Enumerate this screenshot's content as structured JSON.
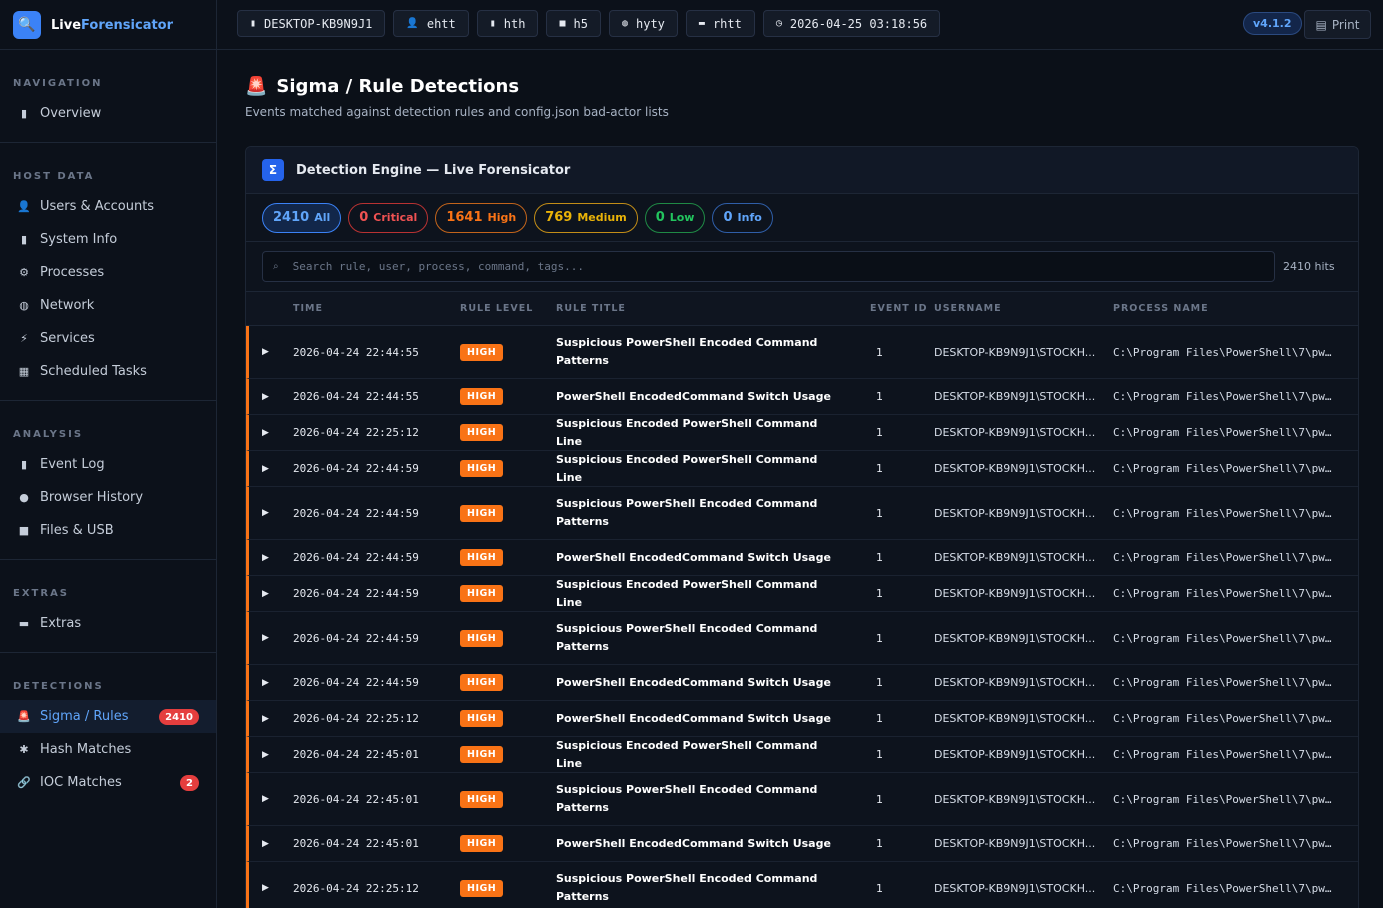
{
  "brand": {
    "name_a": "Live",
    "name_b": "Forensicator",
    "icon": "magnifier-icon"
  },
  "topbar": {
    "chips": [
      {
        "icon": "computer-icon",
        "glyph": "▮",
        "label": "DESKTOP-KB9N9J1"
      },
      {
        "icon": "user-icon",
        "glyph": "👤",
        "label": "ehtt"
      },
      {
        "icon": "document-icon",
        "glyph": "▮",
        "label": "hth"
      },
      {
        "icon": "folder-icon",
        "glyph": "■",
        "label": "h5"
      },
      {
        "icon": "globe-icon",
        "glyph": "◍",
        "label": "hyty"
      },
      {
        "icon": "monitor-icon",
        "glyph": "▬",
        "label": "rhtt"
      },
      {
        "icon": "clock-icon",
        "glyph": "◷",
        "label": "2026-04-25 03:18:56"
      }
    ],
    "version": "v4.1.2",
    "print_label": "Print"
  },
  "sidebar": {
    "sections": [
      {
        "title": "NAVIGATION",
        "items": [
          {
            "label": "Overview",
            "icon": "chart-icon",
            "glyph": "▮"
          }
        ]
      },
      {
        "title": "HOST DATA",
        "items": [
          {
            "label": "Users & Accounts",
            "icon": "user-icon",
            "glyph": "👤"
          },
          {
            "label": "System Info",
            "icon": "computer-icon",
            "glyph": "▮"
          },
          {
            "label": "Processes",
            "icon": "gear-icon",
            "glyph": "⚙"
          },
          {
            "label": "Network",
            "icon": "globe-icon",
            "glyph": "◍"
          },
          {
            "label": "Services",
            "icon": "lightning-icon",
            "glyph": "⚡"
          },
          {
            "label": "Scheduled Tasks",
            "icon": "calendar-icon",
            "glyph": "▦"
          }
        ]
      },
      {
        "title": "ANALYSIS",
        "items": [
          {
            "label": "Event Log",
            "icon": "clipboard-icon",
            "glyph": "▮"
          },
          {
            "label": "Browser History",
            "icon": "earth-icon",
            "glyph": "●"
          },
          {
            "label": "Files & USB",
            "icon": "folder-icon",
            "glyph": "■"
          }
        ]
      },
      {
        "title": "EXTRAS",
        "items": [
          {
            "label": "Extras",
            "icon": "toolbox-icon",
            "glyph": "▬"
          }
        ]
      },
      {
        "title": "DETECTIONS",
        "items": [
          {
            "label": "Sigma / Rules",
            "icon": "siren-icon",
            "glyph": "🚨",
            "badge": "2410",
            "active": true
          },
          {
            "label": "Hash Matches",
            "icon": "bug-icon",
            "glyph": "✱"
          },
          {
            "label": "IOC Matches",
            "icon": "link-icon",
            "glyph": "🔗",
            "badge": "2"
          }
        ]
      }
    ]
  },
  "page": {
    "title": "Sigma / Rule Detections",
    "subtitle": "Events matched against detection rules and config.json bad-actor lists",
    "card_title": "Detection Engine — Live Forensicator",
    "card_icon_text": "Σ"
  },
  "filters": [
    {
      "key": "all",
      "count": "2410",
      "label": "All"
    },
    {
      "key": "critical",
      "count": "0",
      "label": "Critical"
    },
    {
      "key": "high",
      "count": "1641",
      "label": "High"
    },
    {
      "key": "medium",
      "count": "769",
      "label": "Medium"
    },
    {
      "key": "low",
      "count": "0",
      "label": "Low"
    },
    {
      "key": "info",
      "count": "0",
      "label": "Info"
    }
  ],
  "search": {
    "placeholder": "Search rule, user, process, command, tags...",
    "value": "",
    "hits": "2410 hits"
  },
  "table": {
    "columns": [
      "TIME",
      "RULE LEVEL",
      "RULE TITLE",
      "EVENT ID",
      "USERNAME",
      "PROCESS NAME"
    ],
    "rows": [
      {
        "time": "2026-04-24 22:44:55",
        "level": "HIGH",
        "title": "Suspicious PowerShell Encoded Command Patterns",
        "eid": "1",
        "user": "DESKTOP-KB9N9J1\\STOCKH...",
        "proc": "C:\\Program Files\\PowerShell\\7\\pw…",
        "tall": true
      },
      {
        "time": "2026-04-24 22:44:55",
        "level": "HIGH",
        "title": "PowerShell EncodedCommand Switch Usage",
        "eid": "1",
        "user": "DESKTOP-KB9N9J1\\STOCKH...",
        "proc": "C:\\Program Files\\PowerShell\\7\\pw…",
        "tall": false
      },
      {
        "time": "2026-04-24 22:25:12",
        "level": "HIGH",
        "title": "Suspicious Encoded PowerShell Command Line",
        "eid": "1",
        "user": "DESKTOP-KB9N9J1\\STOCKH...",
        "proc": "C:\\Program Files\\PowerShell\\7\\pw…",
        "tall": false
      },
      {
        "time": "2026-04-24 22:44:59",
        "level": "HIGH",
        "title": "Suspicious Encoded PowerShell Command Line",
        "eid": "1",
        "user": "DESKTOP-KB9N9J1\\STOCKH...",
        "proc": "C:\\Program Files\\PowerShell\\7\\pw…",
        "tall": false
      },
      {
        "time": "2026-04-24 22:44:59",
        "level": "HIGH",
        "title": "Suspicious PowerShell Encoded Command Patterns",
        "eid": "1",
        "user": "DESKTOP-KB9N9J1\\STOCKH...",
        "proc": "C:\\Program Files\\PowerShell\\7\\pw…",
        "tall": true
      },
      {
        "time": "2026-04-24 22:44:59",
        "level": "HIGH",
        "title": "PowerShell EncodedCommand Switch Usage",
        "eid": "1",
        "user": "DESKTOP-KB9N9J1\\STOCKH...",
        "proc": "C:\\Program Files\\PowerShell\\7\\pw…",
        "tall": false
      },
      {
        "time": "2026-04-24 22:44:59",
        "level": "HIGH",
        "title": "Suspicious Encoded PowerShell Command Line",
        "eid": "1",
        "user": "DESKTOP-KB9N9J1\\STOCKH...",
        "proc": "C:\\Program Files\\PowerShell\\7\\pw…",
        "tall": false
      },
      {
        "time": "2026-04-24 22:44:59",
        "level": "HIGH",
        "title": "Suspicious PowerShell Encoded Command Patterns",
        "eid": "1",
        "user": "DESKTOP-KB9N9J1\\STOCKH...",
        "proc": "C:\\Program Files\\PowerShell\\7\\pw…",
        "tall": true
      },
      {
        "time": "2026-04-24 22:44:59",
        "level": "HIGH",
        "title": "PowerShell EncodedCommand Switch Usage",
        "eid": "1",
        "user": "DESKTOP-KB9N9J1\\STOCKH...",
        "proc": "C:\\Program Files\\PowerShell\\7\\pw…",
        "tall": false
      },
      {
        "time": "2026-04-24 22:25:12",
        "level": "HIGH",
        "title": "PowerShell EncodedCommand Switch Usage",
        "eid": "1",
        "user": "DESKTOP-KB9N9J1\\STOCKH...",
        "proc": "C:\\Program Files\\PowerShell\\7\\pw…",
        "tall": false
      },
      {
        "time": "2026-04-24 22:45:01",
        "level": "HIGH",
        "title": "Suspicious Encoded PowerShell Command Line",
        "eid": "1",
        "user": "DESKTOP-KB9N9J1\\STOCKH...",
        "proc": "C:\\Program Files\\PowerShell\\7\\pw…",
        "tall": false
      },
      {
        "time": "2026-04-24 22:45:01",
        "level": "HIGH",
        "title": "Suspicious PowerShell Encoded Command Patterns",
        "eid": "1",
        "user": "DESKTOP-KB9N9J1\\STOCKH...",
        "proc": "C:\\Program Files\\PowerShell\\7\\pw…",
        "tall": true
      },
      {
        "time": "2026-04-24 22:45:01",
        "level": "HIGH",
        "title": "PowerShell EncodedCommand Switch Usage",
        "eid": "1",
        "user": "DESKTOP-KB9N9J1\\STOCKH...",
        "proc": "C:\\Program Files\\PowerShell\\7\\pw…",
        "tall": false
      },
      {
        "time": "2026-04-24 22:25:12",
        "level": "HIGH",
        "title": "Suspicious PowerShell Encoded Command Patterns",
        "eid": "1",
        "user": "DESKTOP-KB9N9J1\\STOCKH...",
        "proc": "C:\\Program Files\\PowerShell\\7\\pw…",
        "tall": true
      }
    ]
  },
  "colors": {
    "accent": "#3b82f6",
    "high": "#f97316",
    "critical": "#e53e3e",
    "medium": "#eab308",
    "low": "#22c55e",
    "bg": "#0b1018"
  }
}
